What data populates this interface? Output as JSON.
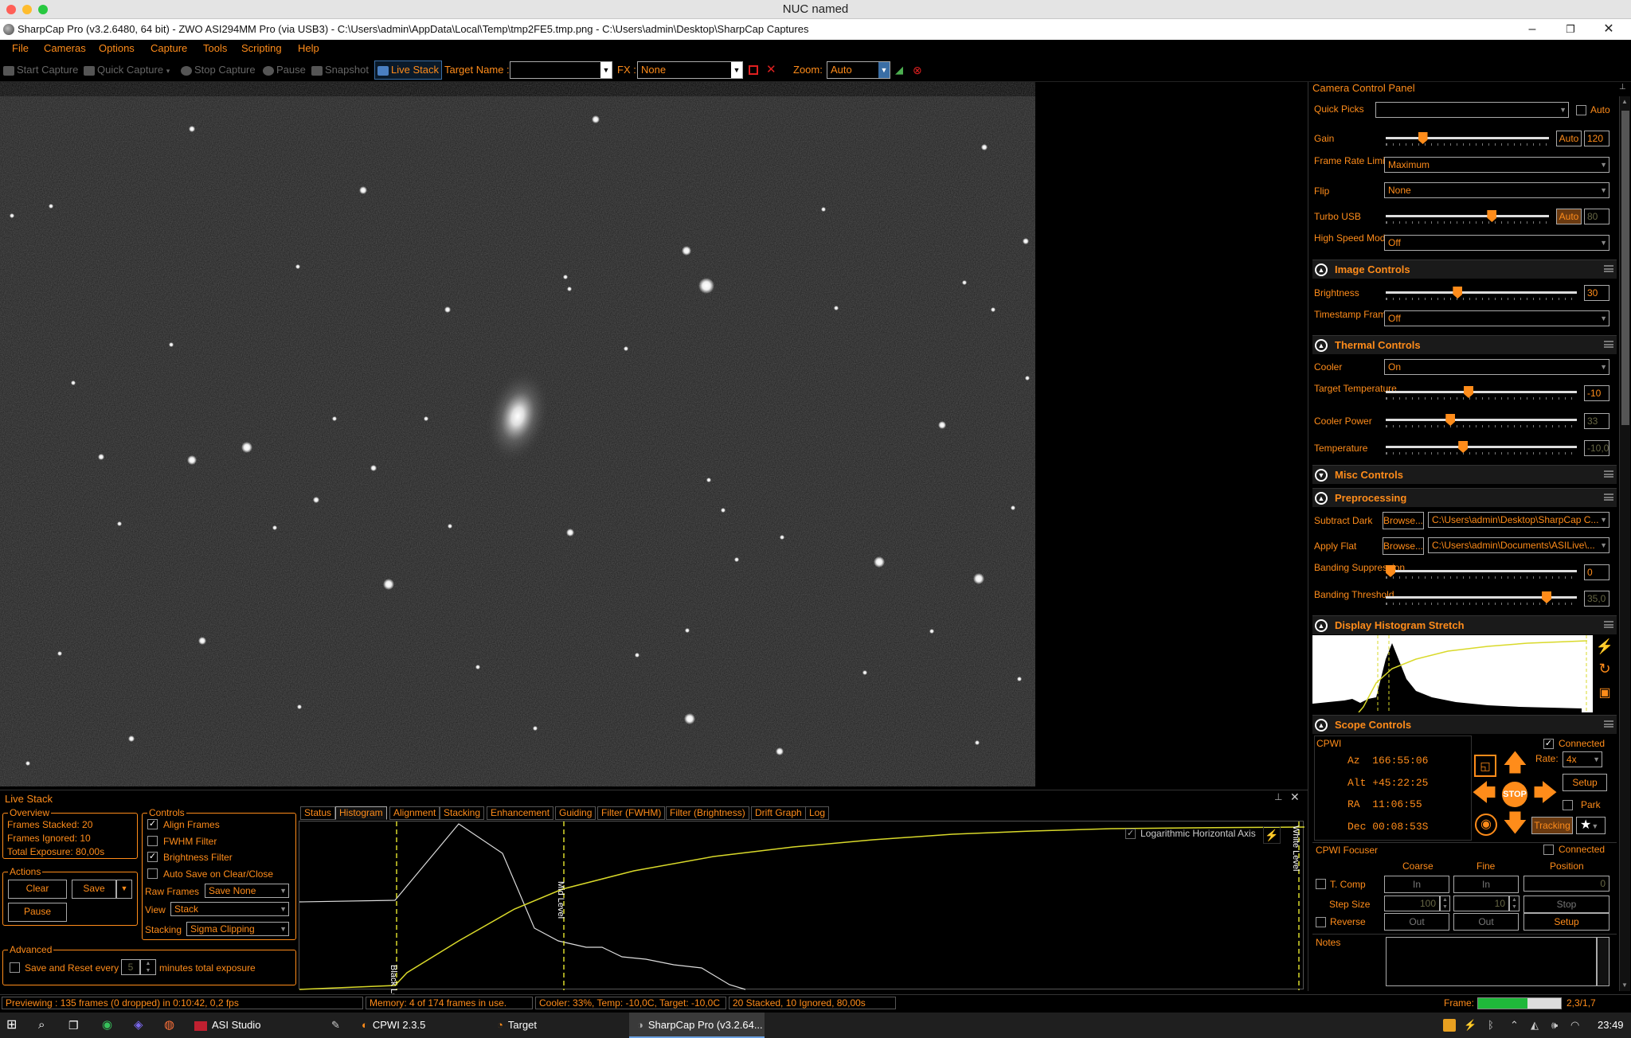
{
  "window": {
    "mac_title": "NUC named",
    "app_title": "SharpCap Pro (v3.2.6480, 64 bit) - ZWO ASI294MM Pro (via USB3) - C:\\Users\\admin\\AppData\\Local\\Temp\\tmp2FE5.tmp.png - C:\\Users\\admin\\Desktop\\SharpCap Captures",
    "minimize": "–",
    "restore": "❐",
    "close": "✕"
  },
  "menu": [
    "File",
    "Cameras",
    "Options",
    "Capture",
    "Tools",
    "Scripting",
    "Help"
  ],
  "toolbar": {
    "start_capture": "Start Capture",
    "quick_capture": "Quick Capture",
    "stop_capture": "Stop Capture",
    "pause": "Pause",
    "snapshot": "Snapshot",
    "live_stack": "Live Stack",
    "target_name_label": "Target Name :",
    "target_name_value": "",
    "fx_label": "FX :",
    "fx_value": "None",
    "zoom_label": "Zoom:",
    "zoom_value": "Auto"
  },
  "camera_panel": {
    "title": "Camera Control Panel",
    "quick_picks_label": "Quick Picks",
    "quick_picks_value": "",
    "quick_picks_auto": "Auto",
    "gain_label": "Gain",
    "gain_auto": "Auto",
    "gain_value": "120",
    "gain_level": 0.21,
    "frame_rate_label": "Frame Rate Limit",
    "frame_rate_value": "Maximum",
    "flip_label": "Flip",
    "flip_value": "None",
    "turbo_usb_label": "Turbo USB",
    "turbo_usb_auto": "Auto",
    "turbo_usb_value": "80",
    "turbo_level": 0.66,
    "high_speed_label": "High Speed Mode",
    "high_speed_value": "Off",
    "image_controls": "Image Controls",
    "brightness_label": "Brightness",
    "brightness_value": "30",
    "brightness_level": 0.37,
    "timestamp_label": "Timestamp Frames",
    "timestamp_value": "Off",
    "thermal_controls": "Thermal Controls",
    "cooler_label": "Cooler",
    "cooler_value": "On",
    "target_temp_label": "Target Temperature",
    "target_temp_value": "-10",
    "target_temp_level": 0.43,
    "cooler_power_label": "Cooler Power",
    "cooler_power_value": "33",
    "cooler_power_level": 0.33,
    "temperature_label": "Temperature",
    "temperature_value": "-10,0",
    "temperature_level": 0.4,
    "misc_controls": "Misc Controls",
    "preprocessing": "Preprocessing",
    "subtract_dark_label": "Subtract Dark",
    "browse": "Browse...",
    "subtract_dark_value": "C:\\Users\\admin\\Desktop\\SharpCap C...",
    "apply_flat_label": "Apply Flat",
    "apply_flat_value": "C:\\Users\\admin\\Documents\\ASILive\\...",
    "banding_supp_label": "Banding Suppression",
    "banding_supp_value": "0",
    "banding_supp_level": 0.0,
    "banding_thresh_label": "Banding Threshold",
    "banding_thresh_value": "35,0",
    "banding_thresh_level": 0.86,
    "histogram_stretch": "Display Histogram Stretch",
    "scope_controls": "Scope Controls",
    "scope_name": "CPWI",
    "connected": "Connected",
    "az": "Az  166:55:06",
    "alt": "Alt +45:22:25",
    "ra": "RA  11:06:55",
    "dec": "Dec 00:08:53S",
    "rate_label": "Rate:",
    "rate_value": "4x",
    "setup": "Setup",
    "park": "Park",
    "stop": "STOP",
    "tracking": "Tracking",
    "focuser_title": "CPWI Focuser",
    "focuser_connected": "Connected",
    "coarse": "Coarse",
    "fine": "Fine",
    "position": "Position",
    "tcomp": "T. Comp",
    "in": "In",
    "position_value": "0",
    "step_size": "Step Size",
    "coarse_step": "100",
    "fine_step": "10",
    "stop_btn": "Stop",
    "reverse": "Reverse",
    "out": "Out",
    "setup2": "Setup",
    "notes": "Notes"
  },
  "live_stack": {
    "title": "Live Stack",
    "overview": "Overview",
    "frames_stacked": "Frames Stacked:  20",
    "frames_ignored": "Frames Ignored:   10",
    "total_exposure": "Total Exposure:   80,00s",
    "actions": "Actions",
    "clear": "Clear",
    "save": "Save",
    "pause": "Pause",
    "controls": "Controls",
    "align_frames": "Align Frames",
    "fwhm_filter": "FWHM Filter",
    "brightness_filter": "Brightness Filter",
    "auto_save": "Auto Save on Clear/Close",
    "raw_frames_label": "Raw Frames",
    "raw_frames_value": "Save None",
    "view_label": "View",
    "view_value": "Stack",
    "stacking_label": "Stacking",
    "stacking_value": "Sigma Clipping",
    "advanced": "Advanced",
    "save_reset": "Save and Reset every",
    "minutes_value": "5",
    "minutes_label": "minutes total exposure",
    "tabs": [
      "Status",
      "Histogram",
      "Alignment",
      "Stacking",
      "Enhancement",
      "Guiding",
      "Filter (FWHM)",
      "Filter (Brightness)",
      "Drift Graph",
      "Log"
    ],
    "log_axis": "Logarithmic Horizontal Axis",
    "black_level": "Black Level",
    "mid_level": "Mid Level",
    "white_level": "White Level"
  },
  "status_bar": {
    "previewing": "Previewing : 135 frames (0 dropped) in 0:10:42, 0,2 fps",
    "memory": "Memory: 4 of 174 frames in use.",
    "cooler": "Cooler: 33%, Temp: -10,0C, Target: -10,0C",
    "stacked": "20 Stacked, 10 Ignored, 80,00s",
    "frame_label": "Frame:",
    "frame_value": "2,3/1,7",
    "frame_level": 0.6
  },
  "taskbar": {
    "asi_studio": "ASI Studio",
    "cpwi": "CPWI 2.3.5",
    "target": "Target",
    "sharpcap": "SharpCap Pro (v3.2.64...",
    "clock": "23:49"
  },
  "colors": {
    "accent": "#ff8c1a",
    "background": "#000000",
    "hist_yellow": "#d9d92a"
  }
}
